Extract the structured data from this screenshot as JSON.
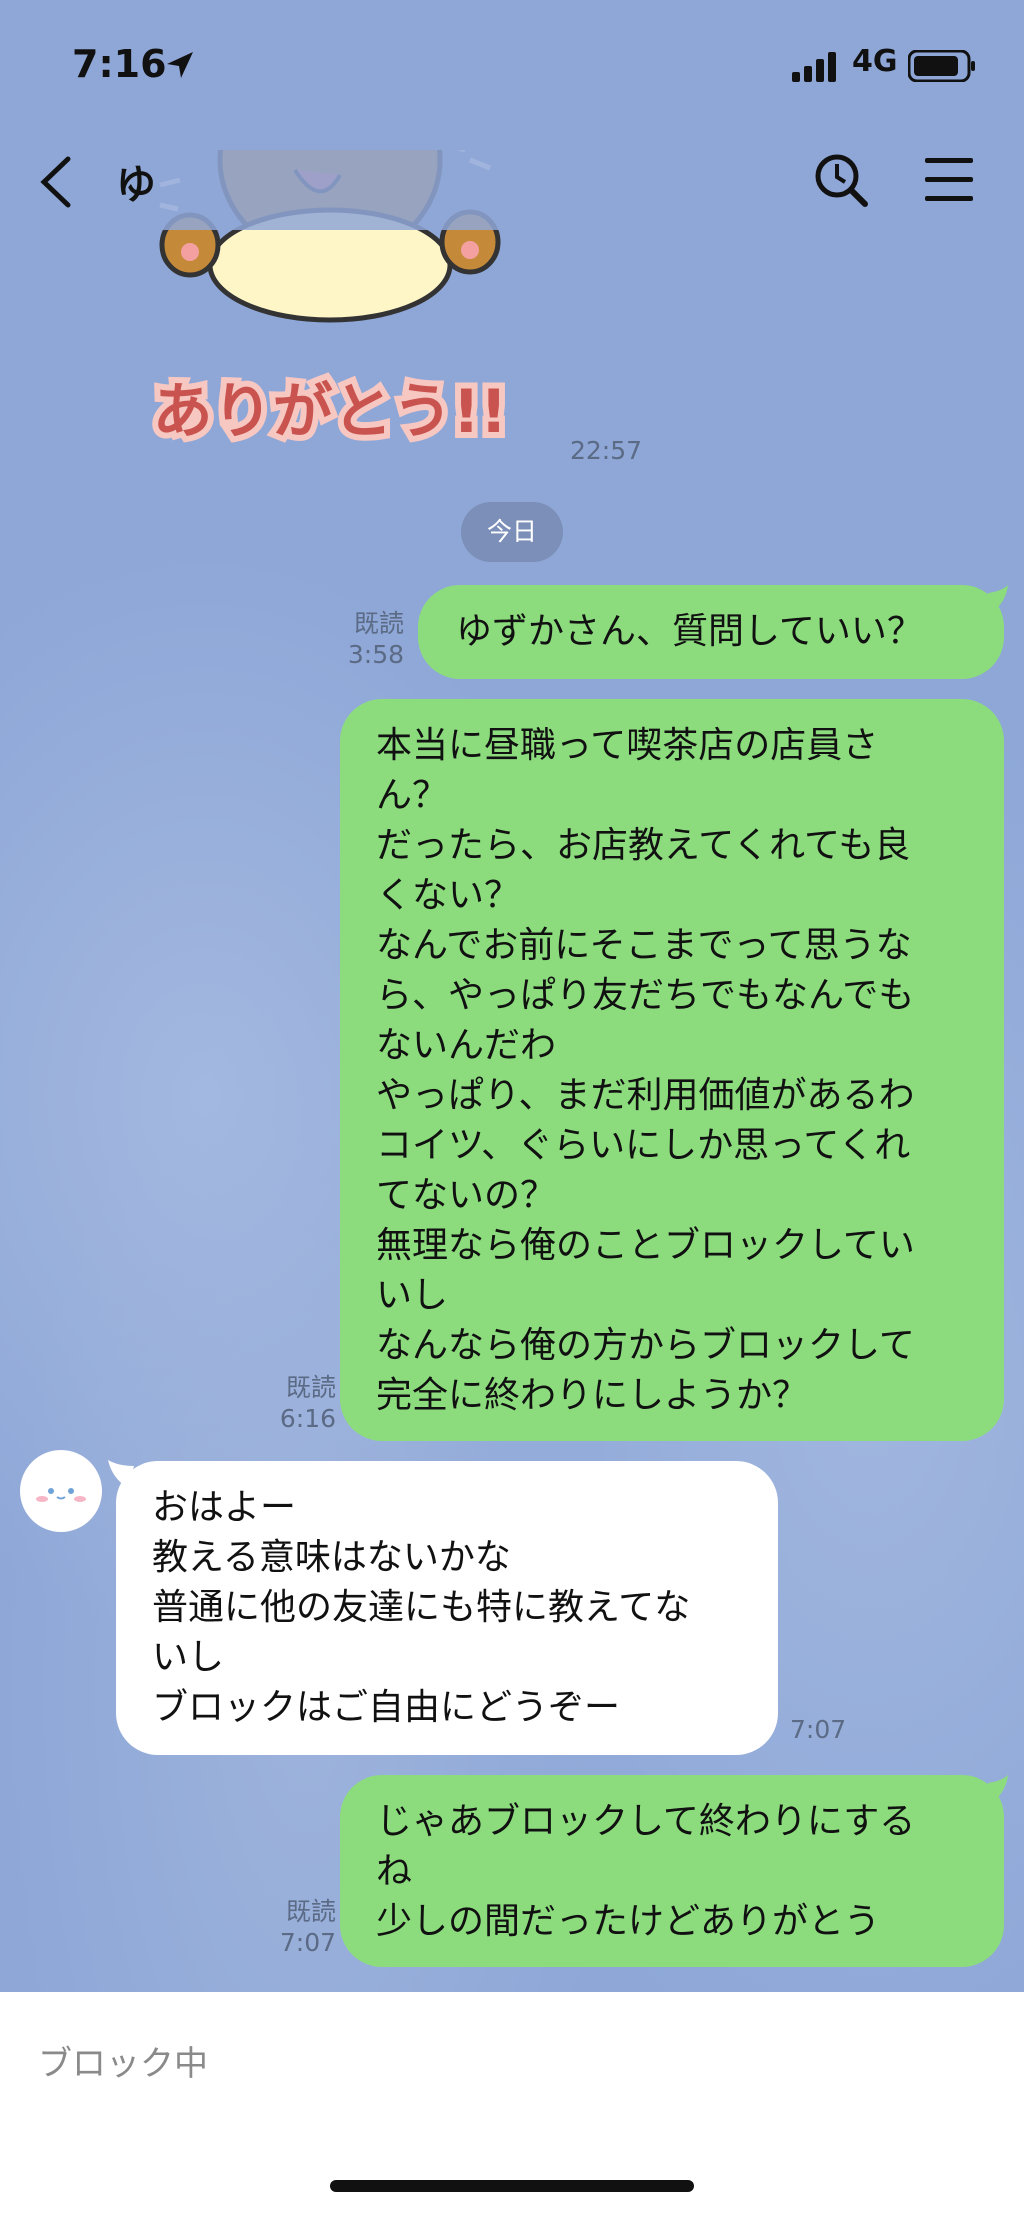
{
  "status_bar": {
    "time": "7:16",
    "network": "4G"
  },
  "header": {
    "title": "ゆ"
  },
  "sticker": {
    "text": "ありがとう!!"
  },
  "messages": [
    {
      "id": "m0",
      "time": "22:57"
    },
    {
      "id": "date",
      "label": "今日"
    },
    {
      "id": "m1",
      "direction": "out",
      "read": "既読",
      "time": "3:58",
      "lines": [
        "ゆずかさん、質問していい？"
      ]
    },
    {
      "id": "m2",
      "direction": "out",
      "read": "既読",
      "time": "6:16",
      "lines": [
        "本当に昼職って喫茶店の店員さ",
        "ん？",
        "だったら、お店教えてくれても良",
        "くない？",
        "なんでお前にそこまでって思うな",
        "ら、やっぱり友だちでもなんでも",
        "ないんだわ",
        "やっぱり、まだ利用価値があるわ",
        "コイツ、ぐらいにしか思ってくれ",
        "てないの？",
        "無理なら俺のことブロックしてい",
        "いし",
        "なんなら俺の方からブロックして",
        "完全に終わりにしようか？"
      ]
    },
    {
      "id": "m3",
      "direction": "in",
      "time": "7:07",
      "lines": [
        "おはよー",
        "教える意味はないかな",
        "普通に他の友達にも特に教えてな",
        "いし",
        "ブロックはご自由にどうぞー"
      ]
    },
    {
      "id": "m4",
      "direction": "out",
      "read": "既読",
      "time": "7:07",
      "lines": [
        "じゃあブロックして終わりにする",
        "ね",
        "少しの間だったけどありがとう"
      ]
    }
  ],
  "input": {
    "blocked_label": "ブロック中"
  },
  "colors": {
    "background": "#8ea7d7",
    "outgoing_bubble": "#8cdc7e",
    "incoming_bubble": "#ffffff",
    "date_pill": "#7b8fb8"
  }
}
